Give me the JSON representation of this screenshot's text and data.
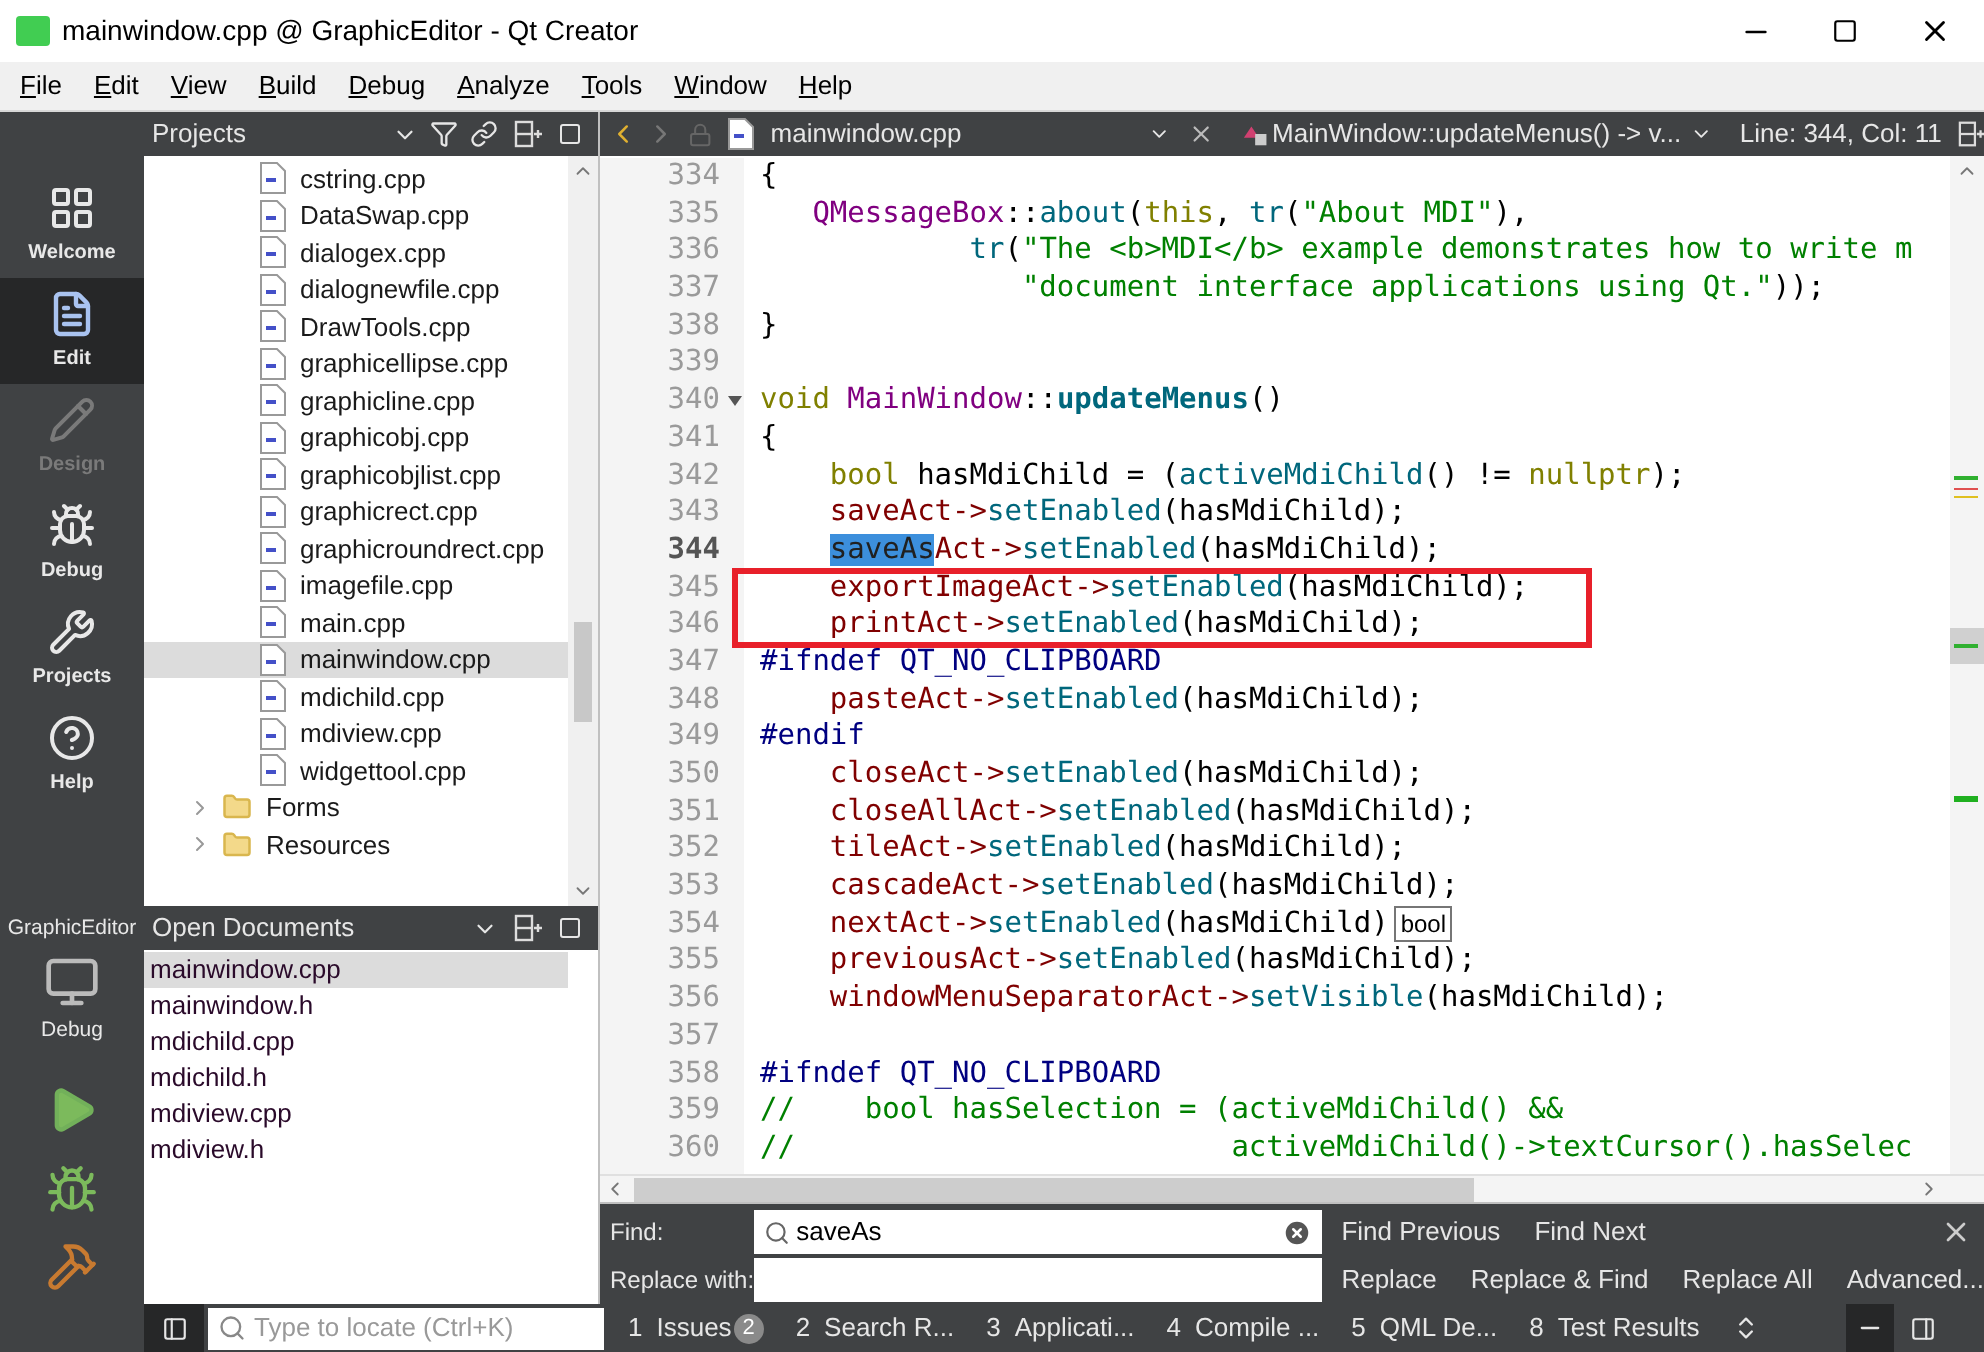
{
  "window": {
    "title": "mainwindow.cpp @ GraphicEditor - Qt Creator"
  },
  "menu": [
    "File",
    "Edit",
    "View",
    "Build",
    "Debug",
    "Analyze",
    "Tools",
    "Window",
    "Help"
  ],
  "modes": [
    {
      "label": "Welcome",
      "selected": false,
      "disabled": false
    },
    {
      "label": "Edit",
      "selected": true,
      "disabled": false
    },
    {
      "label": "Design",
      "selected": false,
      "disabled": true
    },
    {
      "label": "Debug",
      "selected": false,
      "disabled": false
    },
    {
      "label": "Projects",
      "selected": false,
      "disabled": false
    },
    {
      "label": "Help",
      "selected": false,
      "disabled": false
    }
  ],
  "kit": {
    "project": "GraphicEditor",
    "config": "Debug"
  },
  "projects_pane": {
    "title": "Projects",
    "items": [
      {
        "kind": "file",
        "name": "cstring.cpp",
        "selected": false
      },
      {
        "kind": "file",
        "name": "DataSwap.cpp",
        "selected": false
      },
      {
        "kind": "file",
        "name": "dialogex.cpp",
        "selected": false
      },
      {
        "kind": "file",
        "name": "dialognewfile.cpp",
        "selected": false
      },
      {
        "kind": "file",
        "name": "DrawTools.cpp",
        "selected": false
      },
      {
        "kind": "file",
        "name": "graphicellipse.cpp",
        "selected": false
      },
      {
        "kind": "file",
        "name": "graphicline.cpp",
        "selected": false
      },
      {
        "kind": "file",
        "name": "graphicobj.cpp",
        "selected": false
      },
      {
        "kind": "file",
        "name": "graphicobjlist.cpp",
        "selected": false
      },
      {
        "kind": "file",
        "name": "graphicrect.cpp",
        "selected": false
      },
      {
        "kind": "file",
        "name": "graphicroundrect.cpp",
        "selected": false
      },
      {
        "kind": "file",
        "name": "imagefile.cpp",
        "selected": false
      },
      {
        "kind": "file",
        "name": "main.cpp",
        "selected": false
      },
      {
        "kind": "file",
        "name": "mainwindow.cpp",
        "selected": true
      },
      {
        "kind": "file",
        "name": "mdichild.cpp",
        "selected": false
      },
      {
        "kind": "file",
        "name": "mdiview.cpp",
        "selected": false
      },
      {
        "kind": "file",
        "name": "widgettool.cpp",
        "selected": false
      },
      {
        "kind": "folder",
        "name": "Forms",
        "selected": false
      },
      {
        "kind": "folder",
        "name": "Resources",
        "selected": false
      }
    ]
  },
  "open_documents": {
    "title": "Open Documents",
    "items": [
      {
        "name": "mainwindow.cpp",
        "selected": true
      },
      {
        "name": "mainwindow.h",
        "selected": false
      },
      {
        "name": "mdichild.cpp",
        "selected": false
      },
      {
        "name": "mdichild.h",
        "selected": false
      },
      {
        "name": "mdiview.cpp",
        "selected": false
      },
      {
        "name": "mdiview.h",
        "selected": false
      }
    ]
  },
  "locator": {
    "placeholder": "Type to locate (Ctrl+K)"
  },
  "editor": {
    "file": "mainwindow.cpp",
    "symbol": "MainWindow::updateMenus() -> v...",
    "position": "Line: 344, Col: 11",
    "lines": [
      {
        "number": "334",
        "current": false,
        "tokens": [
          {
            "text": "{",
            "kind": "plain"
          }
        ]
      },
      {
        "number": "335",
        "current": false,
        "tokens": [
          {
            "text": "   QMessageBox",
            "kind": "type"
          },
          {
            "text": "::",
            "kind": "plain"
          },
          {
            "text": "about",
            "kind": "function"
          },
          {
            "text": "(",
            "kind": "plain"
          },
          {
            "text": "this",
            "kind": "keyword"
          },
          {
            "text": ", ",
            "kind": "plain"
          },
          {
            "text": "tr",
            "kind": "function"
          },
          {
            "text": "(",
            "kind": "plain"
          },
          {
            "text": "\"About MDI\"",
            "kind": "string"
          },
          {
            "text": "),",
            "kind": "plain"
          }
        ]
      },
      {
        "number": "336",
        "current": false,
        "tokens": [
          {
            "text": "            tr",
            "kind": "function"
          },
          {
            "text": "(",
            "kind": "plain"
          },
          {
            "text": "\"The <b>MDI</b> example demonstrates how to write m",
            "kind": "string"
          }
        ]
      },
      {
        "number": "337",
        "current": false,
        "tokens": [
          {
            "text": "               \"document interface applications using Qt.\"",
            "kind": "string"
          },
          {
            "text": "));",
            "kind": "plain"
          }
        ]
      },
      {
        "number": "338",
        "current": false,
        "tokens": [
          {
            "text": "}",
            "kind": "plain"
          }
        ]
      },
      {
        "number": "339",
        "current": false
      },
      {
        "number": "340",
        "current": false,
        "foldable": true,
        "tokens": [
          {
            "text": "void ",
            "kind": "keyword"
          },
          {
            "text": "MainWindow",
            "kind": "type"
          },
          {
            "text": "::",
            "kind": "plain"
          },
          {
            "text": "updateMenus",
            "kind": "decl"
          },
          {
            "text": "()",
            "kind": "plain"
          }
        ]
      },
      {
        "number": "341",
        "current": false,
        "tokens": [
          {
            "text": "{",
            "kind": "plain"
          }
        ]
      },
      {
        "number": "342",
        "current": false,
        "tokens": [
          {
            "text": "    bool",
            "kind": "keyword"
          },
          {
            "text": " hasMdiChild = (",
            "kind": "plain"
          },
          {
            "text": "activeMdiChild",
            "kind": "function"
          },
          {
            "text": "() != ",
            "kind": "plain"
          },
          {
            "text": "nullptr",
            "kind": "keyword"
          },
          {
            "text": ");",
            "kind": "plain"
          }
        ]
      },
      {
        "number": "343",
        "current": false,
        "tokens": [
          {
            "text": "    saveAct->",
            "kind": "member"
          },
          {
            "text": "setEnabled",
            "kind": "function"
          },
          {
            "text": "(hasMdiChild);",
            "kind": "plain"
          }
        ]
      },
      {
        "number": "344",
        "current": true,
        "tokens": [
          {
            "text": "    saveAs",
            "kind": "selection"
          },
          {
            "text": "Act->",
            "kind": "member"
          },
          {
            "text": "setEnabled",
            "kind": "function"
          },
          {
            "text": "(hasMdiChild);",
            "kind": "plain"
          }
        ]
      },
      {
        "number": "345",
        "current": false,
        "boxed": true,
        "tokens": [
          {
            "text": "    exportImageAct->",
            "kind": "member"
          },
          {
            "text": "setEnabled",
            "kind": "function"
          },
          {
            "text": "(hasMdiChild);",
            "kind": "plain"
          }
        ]
      },
      {
        "number": "346",
        "current": false,
        "boxed": true,
        "tokens": [
          {
            "text": "    printAct->",
            "kind": "member"
          },
          {
            "text": "setEnabled",
            "kind": "function"
          },
          {
            "text": "(hasMdiChild);",
            "kind": "plain"
          }
        ]
      },
      {
        "number": "347",
        "current": false,
        "tokens": [
          {
            "text": "#ifndef QT_NO_CLIPBOARD",
            "kind": "preproc"
          }
        ]
      },
      {
        "number": "348",
        "current": false,
        "tokens": [
          {
            "text": "    pasteAct->",
            "kind": "member"
          },
          {
            "text": "setEnabled",
            "kind": "function"
          },
          {
            "text": "(hasMdiChild);",
            "kind": "plain"
          }
        ]
      },
      {
        "number": "349",
        "current": false,
        "tokens": [
          {
            "text": "#endif",
            "kind": "preproc"
          }
        ]
      },
      {
        "number": "350",
        "current": false,
        "tokens": [
          {
            "text": "    closeAct->",
            "kind": "member"
          },
          {
            "text": "setEnabled",
            "kind": "function"
          },
          {
            "text": "(hasMdiChild);",
            "kind": "plain"
          }
        ]
      },
      {
        "number": "351",
        "current": false,
        "tokens": [
          {
            "text": "    closeAllAct->",
            "kind": "member"
          },
          {
            "text": "setEnabled",
            "kind": "function"
          },
          {
            "text": "(hasMdiChild);",
            "kind": "plain"
          }
        ]
      },
      {
        "number": "352",
        "current": false,
        "tokens": [
          {
            "text": "    tileAct->",
            "kind": "member"
          },
          {
            "text": "setEnabled",
            "kind": "function"
          },
          {
            "text": "(hasMdiChild);",
            "kind": "plain"
          }
        ]
      },
      {
        "number": "353",
        "current": false,
        "tokens": [
          {
            "text": "    cascadeAct->",
            "kind": "member"
          },
          {
            "text": "setEnabled",
            "kind": "function"
          },
          {
            "text": "(hasMdiChild);",
            "kind": "plain"
          }
        ]
      },
      {
        "number": "354",
        "current": false,
        "tooltip": "bool",
        "tokens": [
          {
            "text": "    nextAct->",
            "kind": "member"
          },
          {
            "text": "setEnabled",
            "kind": "function"
          },
          {
            "text": "(hasMdiChild)",
            "kind": "plain"
          }
        ]
      },
      {
        "number": "355",
        "current": false,
        "tokens": [
          {
            "text": "    previousAct->",
            "kind": "member"
          },
          {
            "text": "setEnabled",
            "kind": "function"
          },
          {
            "text": "(hasMdiChild);",
            "kind": "plain"
          }
        ]
      },
      {
        "number": "356",
        "current": false,
        "tokens": [
          {
            "text": "    windowMenuSeparatorAct->",
            "kind": "member"
          },
          {
            "text": "setVisible",
            "kind": "function"
          },
          {
            "text": "(hasMdiChild);",
            "kind": "plain"
          }
        ]
      },
      {
        "number": "357",
        "current": false
      },
      {
        "number": "358",
        "current": false,
        "tokens": [
          {
            "text": "#ifndef QT_NO_CLIPBOARD",
            "kind": "preproc"
          }
        ]
      },
      {
        "number": "359",
        "current": false,
        "tokens": [
          {
            "text": "//    bool hasSelection = (activeMdiChild() &&",
            "kind": "comment"
          }
        ]
      },
      {
        "number": "360",
        "current": false,
        "tokens": [
          {
            "text": "//                         activeMdiChild()->textCursor().hasSelec",
            "kind": "comment"
          }
        ]
      }
    ]
  },
  "find_bar": {
    "find_label": "Find:",
    "find_value": "saveAs",
    "replace_label": "Replace with:",
    "buttons": [
      "Find Previous",
      "Find Next",
      "Replace",
      "Replace & Find",
      "Replace All",
      "Advanced..."
    ]
  },
  "output_tabs": [
    {
      "number": "1",
      "label": "Issues",
      "badge": "2"
    },
    {
      "number": "2",
      "label": "Search R..."
    },
    {
      "number": "3",
      "label": "Applicati..."
    },
    {
      "number": "4",
      "label": "Compile ..."
    },
    {
      "number": "5",
      "label": "QML De..."
    },
    {
      "number": "8",
      "label": "Test Results"
    }
  ]
}
